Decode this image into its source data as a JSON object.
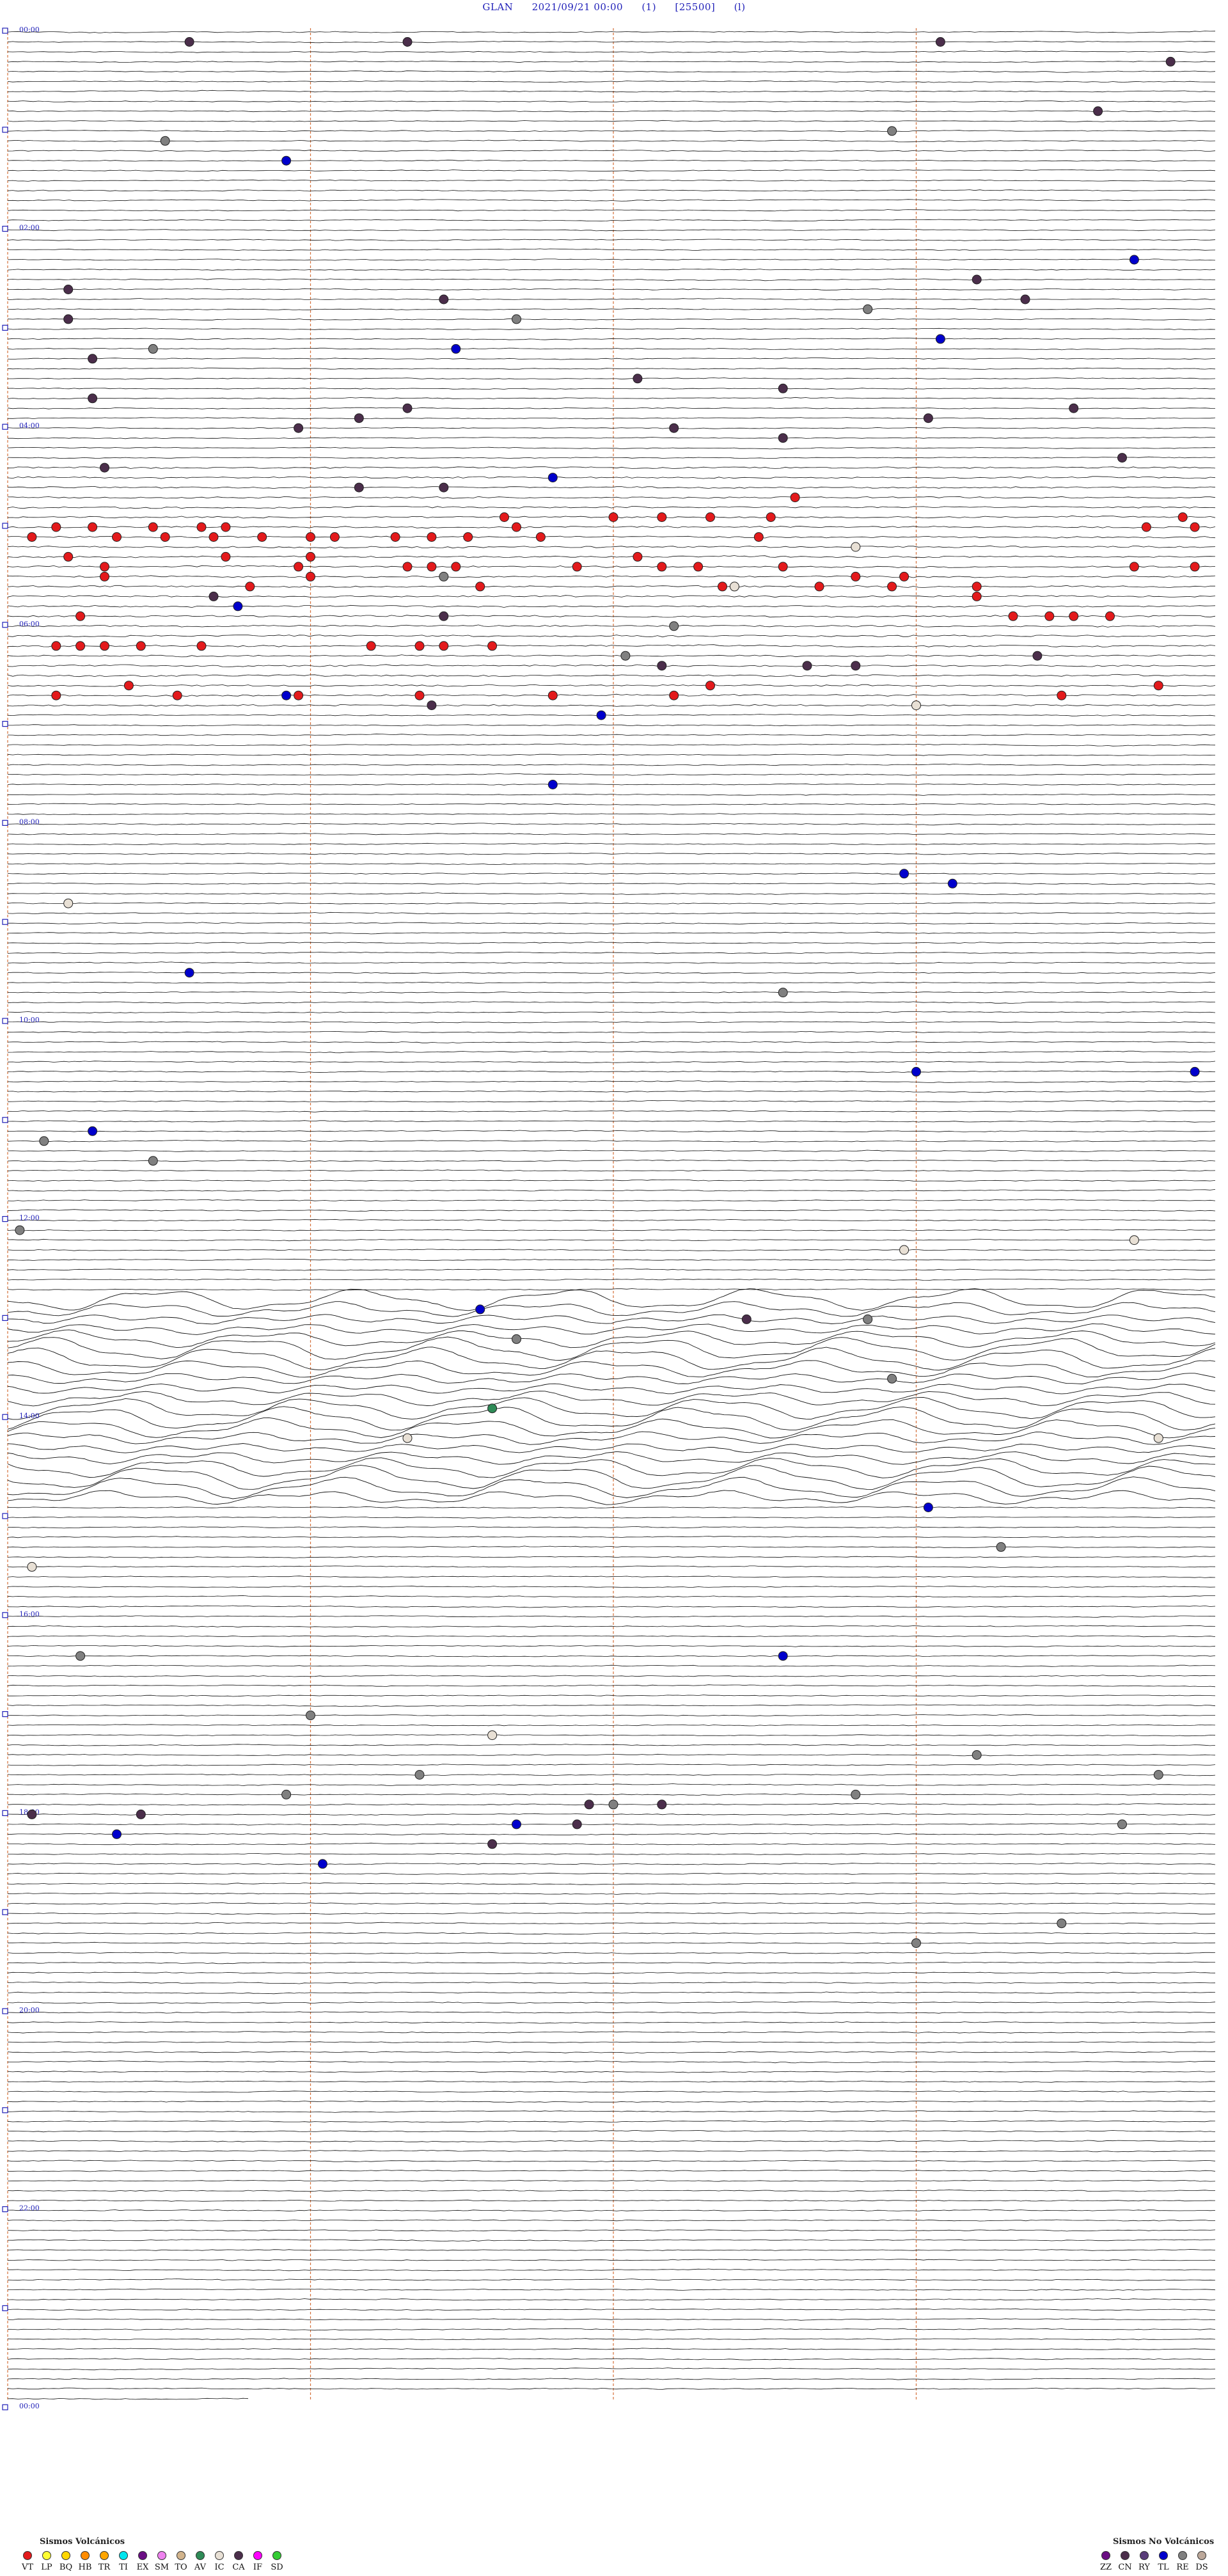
{
  "header": {
    "station": "GLAN",
    "datetime": "2021/09/21 00:00",
    "channel": "(1)",
    "scale": "[25500]",
    "flag": "(l)"
  },
  "chart_data": {
    "type": "scatter",
    "description_free": true,
    "hour_labels": [
      "00:00",
      "02:00",
      "04:00",
      "06:00",
      "08:00",
      "10:00",
      "12:00",
      "14:00",
      "16:00",
      "18:00",
      "20:00",
      "22:00",
      "00:00"
    ],
    "rows_per_hour": 10,
    "total_rows": 240,
    "minutes_per_row": 6,
    "vertical_markers_minute": [
      1.5,
      3.0,
      4.5
    ],
    "events": [
      {
        "row": 1,
        "t": 0.15,
        "cat": "CA"
      },
      {
        "row": 1,
        "t": 0.33,
        "cat": "CA"
      },
      {
        "row": 1,
        "t": 0.77,
        "cat": "CA"
      },
      {
        "row": 3,
        "t": 0.96,
        "cat": "CA"
      },
      {
        "row": 8,
        "t": 0.9,
        "cat": "CA"
      },
      {
        "row": 10,
        "t": 0.73,
        "cat": "RE"
      },
      {
        "row": 11,
        "t": 0.13,
        "cat": "RE"
      },
      {
        "row": 13,
        "t": 0.23,
        "cat": "TL"
      },
      {
        "row": 23,
        "t": 0.93,
        "cat": "TL"
      },
      {
        "row": 25,
        "t": 0.8,
        "cat": "CA"
      },
      {
        "row": 26,
        "t": 0.05,
        "cat": "CA"
      },
      {
        "row": 27,
        "t": 0.36,
        "cat": "CA"
      },
      {
        "row": 27,
        "t": 0.84,
        "cat": "CA"
      },
      {
        "row": 28,
        "t": 0.71,
        "cat": "RE"
      },
      {
        "row": 29,
        "t": 0.42,
        "cat": "RE"
      },
      {
        "row": 29,
        "t": 0.05,
        "cat": "CA"
      },
      {
        "row": 31,
        "t": 0.77,
        "cat": "TL"
      },
      {
        "row": 32,
        "t": 0.12,
        "cat": "RE"
      },
      {
        "row": 32,
        "t": 0.37,
        "cat": "TL"
      },
      {
        "row": 33,
        "t": 0.07,
        "cat": "CA"
      },
      {
        "row": 35,
        "t": 0.52,
        "cat": "CA"
      },
      {
        "row": 36,
        "t": 0.64,
        "cat": "CA"
      },
      {
        "row": 37,
        "t": 0.07,
        "cat": "CA"
      },
      {
        "row": 38,
        "t": 0.33,
        "cat": "CA"
      },
      {
        "row": 38,
        "t": 0.88,
        "cat": "CA"
      },
      {
        "row": 39,
        "t": 0.29,
        "cat": "CA"
      },
      {
        "row": 39,
        "t": 0.76,
        "cat": "CA"
      },
      {
        "row": 40,
        "t": 0.24,
        "cat": "CA"
      },
      {
        "row": 40,
        "t": 0.55,
        "cat": "CA"
      },
      {
        "row": 41,
        "t": 0.64,
        "cat": "CA"
      },
      {
        "row": 43,
        "t": 0.92,
        "cat": "CA"
      },
      {
        "row": 44,
        "t": 0.08,
        "cat": "CA"
      },
      {
        "row": 45,
        "t": 0.45,
        "cat": "TL"
      },
      {
        "row": 46,
        "t": 0.29,
        "cat": "CA"
      },
      {
        "row": 46,
        "t": 0.36,
        "cat": "CA"
      },
      {
        "row": 47,
        "t": 0.65,
        "cat": "VT"
      },
      {
        "row": 49,
        "t": 0.41,
        "cat": "VT"
      },
      {
        "row": 49,
        "t": 0.5,
        "cat": "VT"
      },
      {
        "row": 49,
        "t": 0.54,
        "cat": "VT"
      },
      {
        "row": 49,
        "t": 0.58,
        "cat": "VT"
      },
      {
        "row": 49,
        "t": 0.63,
        "cat": "VT"
      },
      {
        "row": 49,
        "t": 0.97,
        "cat": "VT"
      },
      {
        "row": 50,
        "t": 0.04,
        "cat": "VT"
      },
      {
        "row": 50,
        "t": 0.07,
        "cat": "VT"
      },
      {
        "row": 50,
        "t": 0.12,
        "cat": "VT"
      },
      {
        "row": 50,
        "t": 0.16,
        "cat": "VT"
      },
      {
        "row": 50,
        "t": 0.18,
        "cat": "VT"
      },
      {
        "row": 50,
        "t": 0.42,
        "cat": "VT"
      },
      {
        "row": 50,
        "t": 0.94,
        "cat": "VT"
      },
      {
        "row": 50,
        "t": 0.98,
        "cat": "VT"
      },
      {
        "row": 51,
        "t": 0.02,
        "cat": "VT"
      },
      {
        "row": 51,
        "t": 0.09,
        "cat": "VT"
      },
      {
        "row": 51,
        "t": 0.13,
        "cat": "VT"
      },
      {
        "row": 51,
        "t": 0.17,
        "cat": "VT"
      },
      {
        "row": 51,
        "t": 0.21,
        "cat": "VT"
      },
      {
        "row": 51,
        "t": 0.25,
        "cat": "VT"
      },
      {
        "row": 51,
        "t": 0.27,
        "cat": "VT"
      },
      {
        "row": 51,
        "t": 0.32,
        "cat": "VT"
      },
      {
        "row": 51,
        "t": 0.35,
        "cat": "VT"
      },
      {
        "row": 51,
        "t": 0.38,
        "cat": "VT"
      },
      {
        "row": 51,
        "t": 0.44,
        "cat": "VT"
      },
      {
        "row": 51,
        "t": 0.62,
        "cat": "VT"
      },
      {
        "row": 52,
        "t": 0.7,
        "cat": "IC"
      },
      {
        "row": 53,
        "t": 0.05,
        "cat": "VT"
      },
      {
        "row": 53,
        "t": 0.18,
        "cat": "VT"
      },
      {
        "row": 53,
        "t": 0.25,
        "cat": "VT"
      },
      {
        "row": 53,
        "t": 0.52,
        "cat": "VT"
      },
      {
        "row": 54,
        "t": 0.08,
        "cat": "VT"
      },
      {
        "row": 54,
        "t": 0.24,
        "cat": "VT"
      },
      {
        "row": 54,
        "t": 0.33,
        "cat": "VT"
      },
      {
        "row": 54,
        "t": 0.35,
        "cat": "VT"
      },
      {
        "row": 54,
        "t": 0.37,
        "cat": "VT"
      },
      {
        "row": 54,
        "t": 0.47,
        "cat": "VT"
      },
      {
        "row": 54,
        "t": 0.54,
        "cat": "VT"
      },
      {
        "row": 54,
        "t": 0.57,
        "cat": "VT"
      },
      {
        "row": 54,
        "t": 0.64,
        "cat": "VT"
      },
      {
        "row": 54,
        "t": 0.93,
        "cat": "VT"
      },
      {
        "row": 54,
        "t": 0.98,
        "cat": "VT"
      },
      {
        "row": 55,
        "t": 0.08,
        "cat": "VT"
      },
      {
        "row": 55,
        "t": 0.25,
        "cat": "VT"
      },
      {
        "row": 55,
        "t": 0.36,
        "cat": "RE"
      },
      {
        "row": 55,
        "t": 0.7,
        "cat": "VT"
      },
      {
        "row": 55,
        "t": 0.74,
        "cat": "VT"
      },
      {
        "row": 56,
        "t": 0.2,
        "cat": "VT"
      },
      {
        "row": 56,
        "t": 0.39,
        "cat": "VT"
      },
      {
        "row": 56,
        "t": 0.59,
        "cat": "VT"
      },
      {
        "row": 56,
        "t": 0.6,
        "cat": "IC"
      },
      {
        "row": 56,
        "t": 0.67,
        "cat": "VT"
      },
      {
        "row": 56,
        "t": 0.73,
        "cat": "VT"
      },
      {
        "row": 56,
        "t": 0.8,
        "cat": "VT"
      },
      {
        "row": 57,
        "t": 0.17,
        "cat": "CA"
      },
      {
        "row": 57,
        "t": 0.8,
        "cat": "VT"
      },
      {
        "row": 58,
        "t": 0.19,
        "cat": "TL"
      },
      {
        "row": 59,
        "t": 0.06,
        "cat": "VT"
      },
      {
        "row": 59,
        "t": 0.36,
        "cat": "CA"
      },
      {
        "row": 59,
        "t": 0.83,
        "cat": "VT"
      },
      {
        "row": 59,
        "t": 0.86,
        "cat": "VT"
      },
      {
        "row": 59,
        "t": 0.88,
        "cat": "VT"
      },
      {
        "row": 59,
        "t": 0.91,
        "cat": "VT"
      },
      {
        "row": 60,
        "t": 0.55,
        "cat": "RE"
      },
      {
        "row": 62,
        "t": 0.04,
        "cat": "VT"
      },
      {
        "row": 62,
        "t": 0.06,
        "cat": "VT"
      },
      {
        "row": 62,
        "t": 0.08,
        "cat": "VT"
      },
      {
        "row": 62,
        "t": 0.11,
        "cat": "VT"
      },
      {
        "row": 62,
        "t": 0.16,
        "cat": "VT"
      },
      {
        "row": 62,
        "t": 0.3,
        "cat": "VT"
      },
      {
        "row": 62,
        "t": 0.34,
        "cat": "VT"
      },
      {
        "row": 62,
        "t": 0.36,
        "cat": "VT"
      },
      {
        "row": 62,
        "t": 0.4,
        "cat": "VT"
      },
      {
        "row": 63,
        "t": 0.51,
        "cat": "RE"
      },
      {
        "row": 63,
        "t": 0.85,
        "cat": "CA"
      },
      {
        "row": 64,
        "t": 0.54,
        "cat": "CA"
      },
      {
        "row": 64,
        "t": 0.66,
        "cat": "CA"
      },
      {
        "row": 64,
        "t": 0.7,
        "cat": "CA"
      },
      {
        "row": 66,
        "t": 0.1,
        "cat": "VT"
      },
      {
        "row": 66,
        "t": 0.58,
        "cat": "VT"
      },
      {
        "row": 66,
        "t": 0.95,
        "cat": "VT"
      },
      {
        "row": 67,
        "t": 0.04,
        "cat": "VT"
      },
      {
        "row": 67,
        "t": 0.14,
        "cat": "VT"
      },
      {
        "row": 67,
        "t": 0.24,
        "cat": "VT"
      },
      {
        "row": 67,
        "t": 0.34,
        "cat": "VT"
      },
      {
        "row": 67,
        "t": 0.45,
        "cat": "VT"
      },
      {
        "row": 67,
        "t": 0.55,
        "cat": "VT"
      },
      {
        "row": 67,
        "t": 0.87,
        "cat": "VT"
      },
      {
        "row": 67,
        "t": 0.23,
        "cat": "TL"
      },
      {
        "row": 68,
        "t": 0.35,
        "cat": "CA"
      },
      {
        "row": 68,
        "t": 0.75,
        "cat": "IC"
      },
      {
        "row": 69,
        "t": 0.49,
        "cat": "TL"
      },
      {
        "row": 76,
        "t": 0.45,
        "cat": "TL"
      },
      {
        "row": 85,
        "t": 0.74,
        "cat": "TL"
      },
      {
        "row": 86,
        "t": 0.78,
        "cat": "TL"
      },
      {
        "row": 88,
        "t": 0.05,
        "cat": "IC"
      },
      {
        "row": 95,
        "t": 0.15,
        "cat": "TL"
      },
      {
        "row": 97,
        "t": 0.64,
        "cat": "RE"
      },
      {
        "row": 105,
        "t": 0.75,
        "cat": "TL"
      },
      {
        "row": 105,
        "t": 0.98,
        "cat": "TL"
      },
      {
        "row": 111,
        "t": 0.07,
        "cat": "TL"
      },
      {
        "row": 112,
        "t": 0.03,
        "cat": "RE"
      },
      {
        "row": 114,
        "t": 0.12,
        "cat": "RE"
      },
      {
        "row": 121,
        "t": 0.01,
        "cat": "RE"
      },
      {
        "row": 122,
        "t": 0.93,
        "cat": "IC"
      },
      {
        "row": 123,
        "t": 0.74,
        "cat": "IC"
      },
      {
        "row": 129,
        "t": 0.39,
        "cat": "TL"
      },
      {
        "row": 130,
        "t": 0.61,
        "cat": "CA"
      },
      {
        "row": 130,
        "t": 0.71,
        "cat": "RE"
      },
      {
        "row": 132,
        "t": 0.42,
        "cat": "RE"
      },
      {
        "row": 136,
        "t": 0.73,
        "cat": "RE"
      },
      {
        "row": 139,
        "t": 0.4,
        "cat": "AV"
      },
      {
        "row": 142,
        "t": 0.33,
        "cat": "IC"
      },
      {
        "row": 142,
        "t": 0.95,
        "cat": "IC"
      },
      {
        "row": 149,
        "t": 0.76,
        "cat": "TL"
      },
      {
        "row": 153,
        "t": 0.82,
        "cat": "RE"
      },
      {
        "row": 155,
        "t": 0.02,
        "cat": "IC"
      },
      {
        "row": 164,
        "t": 0.64,
        "cat": "TL"
      },
      {
        "row": 164,
        "t": 0.06,
        "cat": "RE"
      },
      {
        "row": 170,
        "t": 0.25,
        "cat": "RE"
      },
      {
        "row": 172,
        "t": 0.4,
        "cat": "IC"
      },
      {
        "row": 174,
        "t": 0.8,
        "cat": "RE"
      },
      {
        "row": 176,
        "t": 0.34,
        "cat": "RE"
      },
      {
        "row": 176,
        "t": 0.95,
        "cat": "RE"
      },
      {
        "row": 178,
        "t": 0.23,
        "cat": "RE"
      },
      {
        "row": 178,
        "t": 0.7,
        "cat": "RE"
      },
      {
        "row": 179,
        "t": 0.48,
        "cat": "CA"
      },
      {
        "row": 179,
        "t": 0.5,
        "cat": "RE"
      },
      {
        "row": 179,
        "t": 0.54,
        "cat": "CA"
      },
      {
        "row": 180,
        "t": 0.02,
        "cat": "CA"
      },
      {
        "row": 180,
        "t": 0.11,
        "cat": "CA"
      },
      {
        "row": 181,
        "t": 0.42,
        "cat": "TL"
      },
      {
        "row": 181,
        "t": 0.47,
        "cat": "CA"
      },
      {
        "row": 181,
        "t": 0.92,
        "cat": "RE"
      },
      {
        "row": 182,
        "t": 0.09,
        "cat": "TL"
      },
      {
        "row": 183,
        "t": 0.4,
        "cat": "CA"
      },
      {
        "row": 185,
        "t": 0.26,
        "cat": "TL"
      },
      {
        "row": 191,
        "t": 0.87,
        "cat": "RE"
      },
      {
        "row": 193,
        "t": 0.75,
        "cat": "RE"
      }
    ],
    "legend": {
      "volcanic_title": "Sismos Volcánicos",
      "nonvolcanic_title": "Sismos No Volcánicos",
      "volcanic": [
        {
          "code": "VT",
          "color": "#e31a1c"
        },
        {
          "code": "LP",
          "color": "#ffff33"
        },
        {
          "code": "BQ",
          "color": "#ffd700"
        },
        {
          "code": "HB",
          "color": "#ff8c00"
        },
        {
          "code": "TR",
          "color": "#ffa500"
        },
        {
          "code": "TI",
          "color": "#00e5ee"
        },
        {
          "code": "EX",
          "color": "#6a0d83"
        },
        {
          "code": "SM",
          "color": "#ee82ee"
        },
        {
          "code": "TO",
          "color": "#d2b48c"
        },
        {
          "code": "AV",
          "color": "#2e8b57"
        },
        {
          "code": "IC",
          "color": "#f5f5f5"
        },
        {
          "code": "CA",
          "color": "#4b2e4b"
        },
        {
          "code": "IF",
          "color": "#ff00ff"
        },
        {
          "code": "SD",
          "color": "#33cc33"
        }
      ],
      "nonvolcanic": [
        {
          "code": "ZZ",
          "color": "#6a0d83"
        },
        {
          "code": "CN",
          "color": "#4b2e4b"
        },
        {
          "code": "RY",
          "color": "#5a3d7a"
        },
        {
          "code": "TL",
          "color": "#0000cc"
        },
        {
          "code": "RE",
          "color": "#808080"
        },
        {
          "code": "DS",
          "color": "#bca89a"
        }
      ]
    }
  },
  "colors": {
    "trace": "#111111",
    "marker_line": "#d4703a",
    "label_blue": "#1f1fb8",
    "IC_fill": "#e8e0d5"
  }
}
